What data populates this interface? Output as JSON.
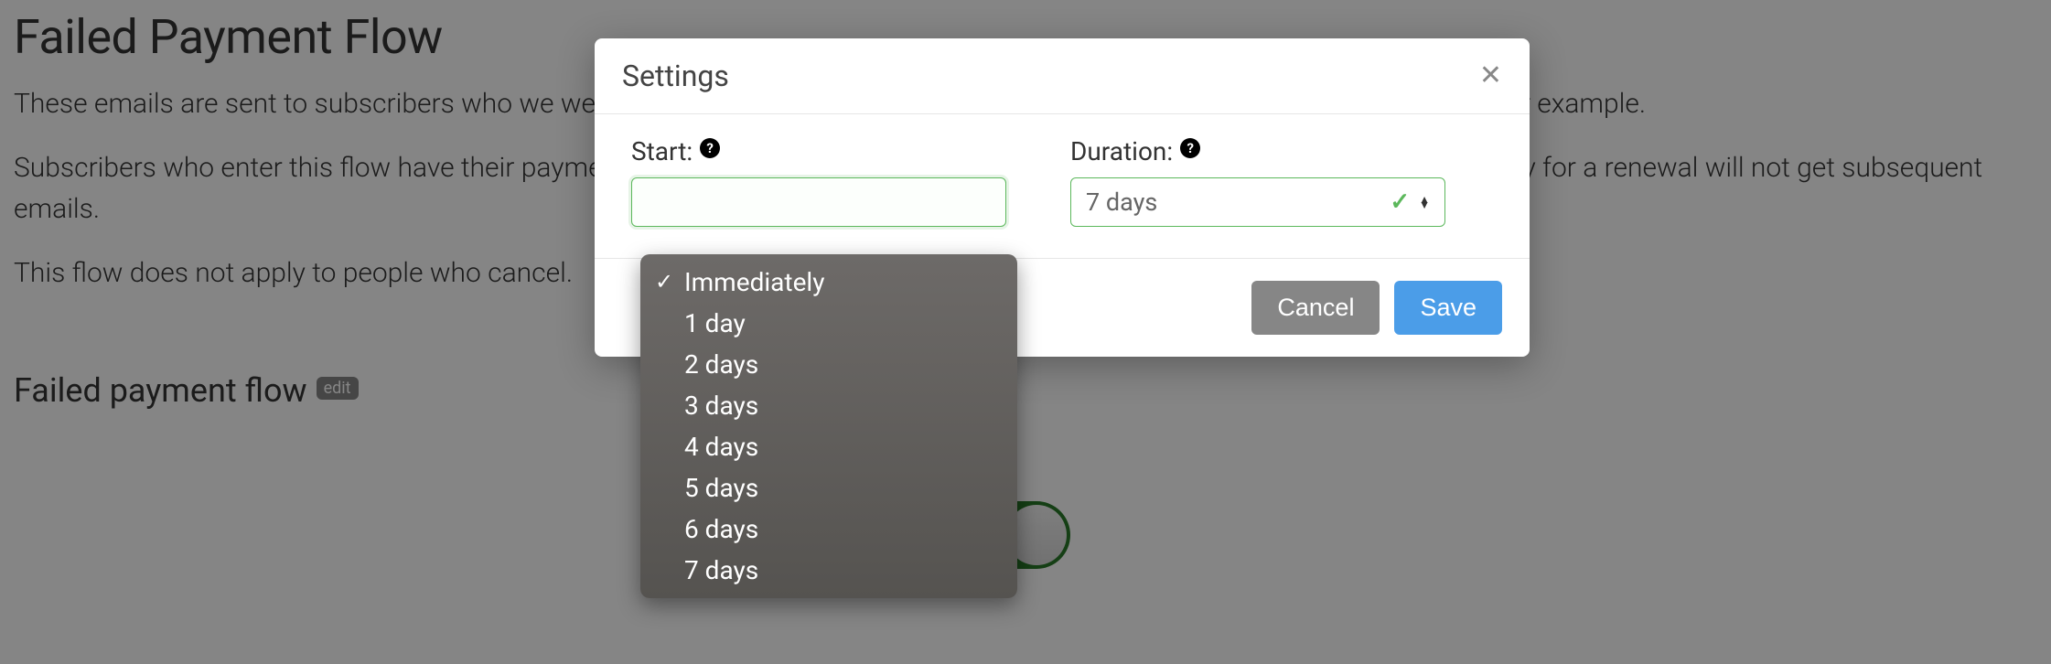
{
  "page": {
    "title": "Failed Payment Flow",
    "desc1": "These emails are sent to subscribers who we were not able to charge for a renewal, because of an expired or canceled card, for example.",
    "desc2": "Subscribers who enter this flow have their payment re-tried periodically. Subscribers who update their payment method and pay for a renewal will not get subsequent emails.",
    "desc3": "This flow does not apply to people who cancel."
  },
  "section": {
    "title": "Failed payment flow",
    "edit_label": "edit"
  },
  "modal": {
    "title": "Settings",
    "start_label": "Start:",
    "duration_label": "Duration:",
    "duration_value": "7 days",
    "cancel_label": "Cancel",
    "save_label": "Save"
  },
  "dropdown": {
    "selected": "Immediately",
    "options": [
      "Immediately",
      "1 day",
      "2 days",
      "3 days",
      "4 days",
      "5 days",
      "6 days",
      "7 days"
    ]
  }
}
